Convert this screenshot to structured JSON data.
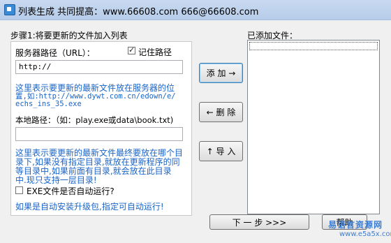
{
  "window": {
    "title": "列表生成   共同提高：www.66608.com   666@66608.com"
  },
  "step": {
    "heading": "步骤1:将要更新的文件加入列表"
  },
  "server": {
    "label": "服务器路径（URL）：",
    "remember_label": "记住路径",
    "remember_checked": true,
    "value": "http://",
    "hint_line1": "这里表示要更新的最新文件放在服务器的位",
    "hint_line2": "置,如:http://www.dywt.com.cn/edown/e/",
    "hint_line3": "echs_ins_35.exe"
  },
  "local": {
    "label": "本地路径：（如：play.exe或data\\book.txt)",
    "value": "",
    "hint_line1": "这里表示要更新的最新文件最终要放在哪个目",
    "hint_line2": "录下,如果没有指定目录,就放在更新程序的同",
    "hint_line3": "等目录中,如果前面有目录,就会放在此目录",
    "hint_line4": "中.现只支持一层目录!"
  },
  "autorun": {
    "label": "EXE文件是否自动运行?",
    "checked": false,
    "hint": "如果是自动安装升级包,指定可自动运行!"
  },
  "buttons": {
    "add": "添 加 →",
    "delete": "← 删 除",
    "import": "↑ 导 入",
    "next": "下  一  步  >>>",
    "help": "帮助"
  },
  "added": {
    "label": "已添加文件：",
    "items": []
  },
  "watermark": {
    "text": "易语言资源网",
    "url": "www.e5a5x.com"
  }
}
